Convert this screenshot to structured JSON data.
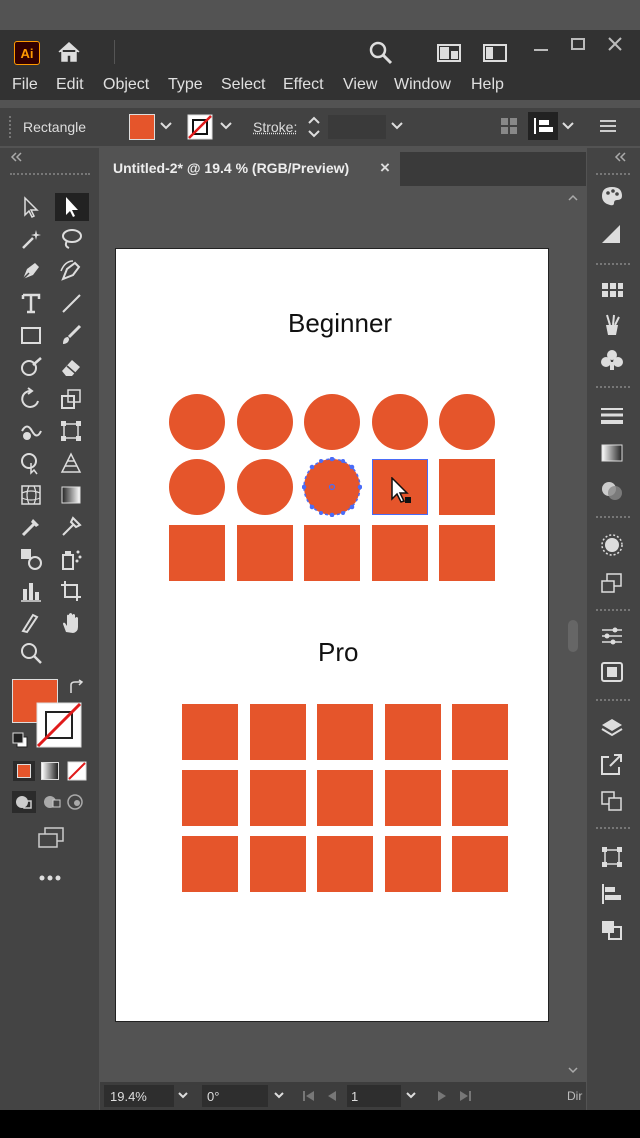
{
  "app": {
    "logo_text": "Ai"
  },
  "menu": [
    "File",
    "Edit",
    "Object",
    "Type",
    "Select",
    "Effect",
    "View",
    "Window",
    "Help"
  ],
  "control": {
    "tool_label": "Rectangle",
    "stroke_label": "Stroke:",
    "fill_color": "#e5552b"
  },
  "document": {
    "tab_title": "Untitled-2* @ 19.4 % (RGB/Preview)",
    "close": "×"
  },
  "artboard": {
    "beginner_title": "Beginner",
    "pro_title": "Pro",
    "shape_color": "#e5552b",
    "selection_color": "#4a6cf7"
  },
  "status": {
    "zoom": "19.4%",
    "rotation": "0°",
    "artboard_number": "1",
    "tool_hint": "Dir"
  }
}
